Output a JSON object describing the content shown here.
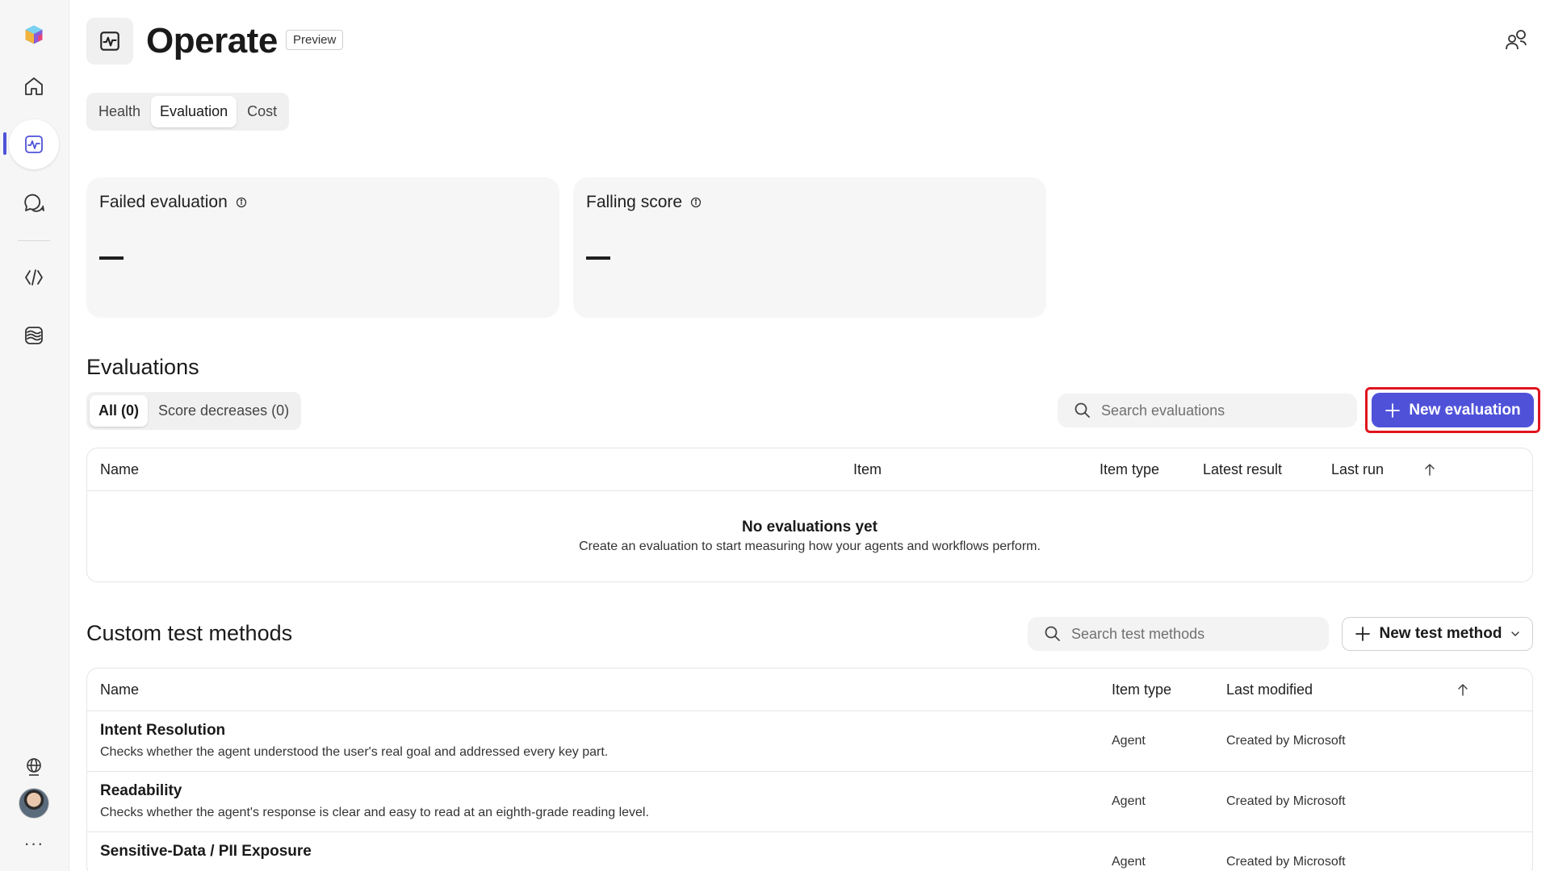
{
  "header": {
    "title": "Operate",
    "badge": "Preview"
  },
  "tabs": [
    {
      "label": "Health",
      "active": false
    },
    {
      "label": "Evaluation",
      "active": true
    },
    {
      "label": "Cost",
      "active": false
    }
  ],
  "metrics": [
    {
      "label": "Failed evaluation",
      "value": "—"
    },
    {
      "label": "Falling score",
      "value": "—"
    }
  ],
  "evaluations": {
    "title": "Evaluations",
    "filters": [
      {
        "label": "All (0)",
        "active": true
      },
      {
        "label": "Score decreases (0)",
        "active": false
      }
    ],
    "search_placeholder": "Search evaluations",
    "new_button": "New evaluation",
    "columns": [
      "Name",
      "Item",
      "Item type",
      "Latest result",
      "Last run"
    ],
    "empty_title": "No evaluations yet",
    "empty_desc": "Create an evaluation to start measuring how your agents and workflows perform."
  },
  "custom_methods": {
    "title": "Custom test methods",
    "search_placeholder": "Search test methods",
    "new_button": "New test method",
    "columns": [
      "Name",
      "Item type",
      "Last modified"
    ],
    "rows": [
      {
        "name": "Intent Resolution",
        "desc": "Checks whether the agent understood the user's real goal and addressed every key part.",
        "type": "Agent",
        "modified": "Created by Microsoft"
      },
      {
        "name": "Readability",
        "desc": "Checks whether the agent's response is clear and easy to read at an eighth-grade reading level.",
        "type": "Agent",
        "modified": "Created by Microsoft"
      },
      {
        "name": "Sensitive-Data / PII Exposure",
        "desc": "",
        "type": "Agent",
        "modified": "Created by Microsoft"
      }
    ]
  },
  "colors": {
    "accent": "#4f52d9",
    "highlight_border": "#e0141e"
  },
  "icons": [
    "app-logo-icon",
    "home-icon",
    "monitor-icon",
    "chat-icon",
    "code-icon",
    "waves-icon",
    "globe-icon",
    "people-icon",
    "search-icon",
    "plus-icon",
    "info-icon",
    "arrow-up-icon",
    "chevron-down-icon"
  ]
}
